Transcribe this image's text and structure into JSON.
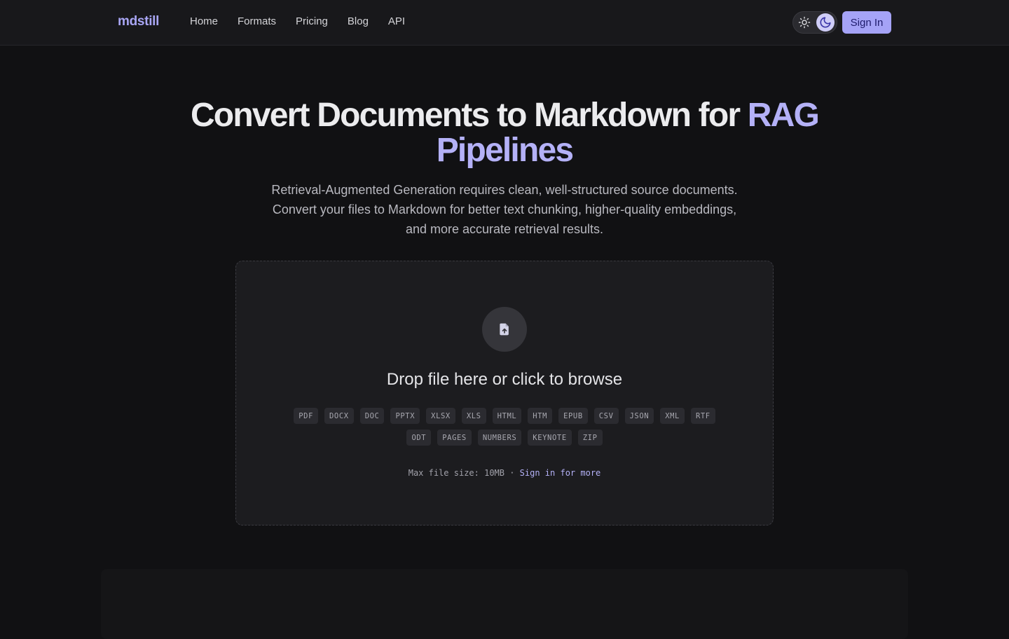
{
  "header": {
    "logo": "mdstill",
    "nav": [
      "Home",
      "Formats",
      "Pricing",
      "Blog",
      "API"
    ],
    "theme": {
      "light_icon": "sun-icon",
      "dark_icon": "moon-icon",
      "active": "dark"
    },
    "sign_in_label": "Sign In"
  },
  "hero": {
    "title_main": "Convert Documents to Markdown for ",
    "title_accent": "RAG Pipelines",
    "subtitle": "Retrieval-Augmented Generation requires clean, well-structured source documents. Convert your files to Markdown for better text chunking, higher-quality embeddings, and more accurate retrieval results."
  },
  "dropzone": {
    "icon": "file-upload-icon",
    "title": "Drop file here or click to browse",
    "formats_row1": [
      "PDF",
      "DOCX",
      "DOC",
      "PPTX",
      "XLSX",
      "XLS",
      "HTML",
      "HTM",
      "EPUB",
      "CSV",
      "JSON",
      "XML",
      "RTF"
    ],
    "formats_row2": [
      "ODT",
      "PAGES",
      "NUMBERS",
      "KEYNOTE",
      "ZIP"
    ],
    "note_prefix": "Max file size: 10MB · ",
    "note_link": "Sign in for more"
  },
  "colors": {
    "accent": "#b4b1f7",
    "background": "#111113",
    "surface": "#1c1c1f"
  }
}
